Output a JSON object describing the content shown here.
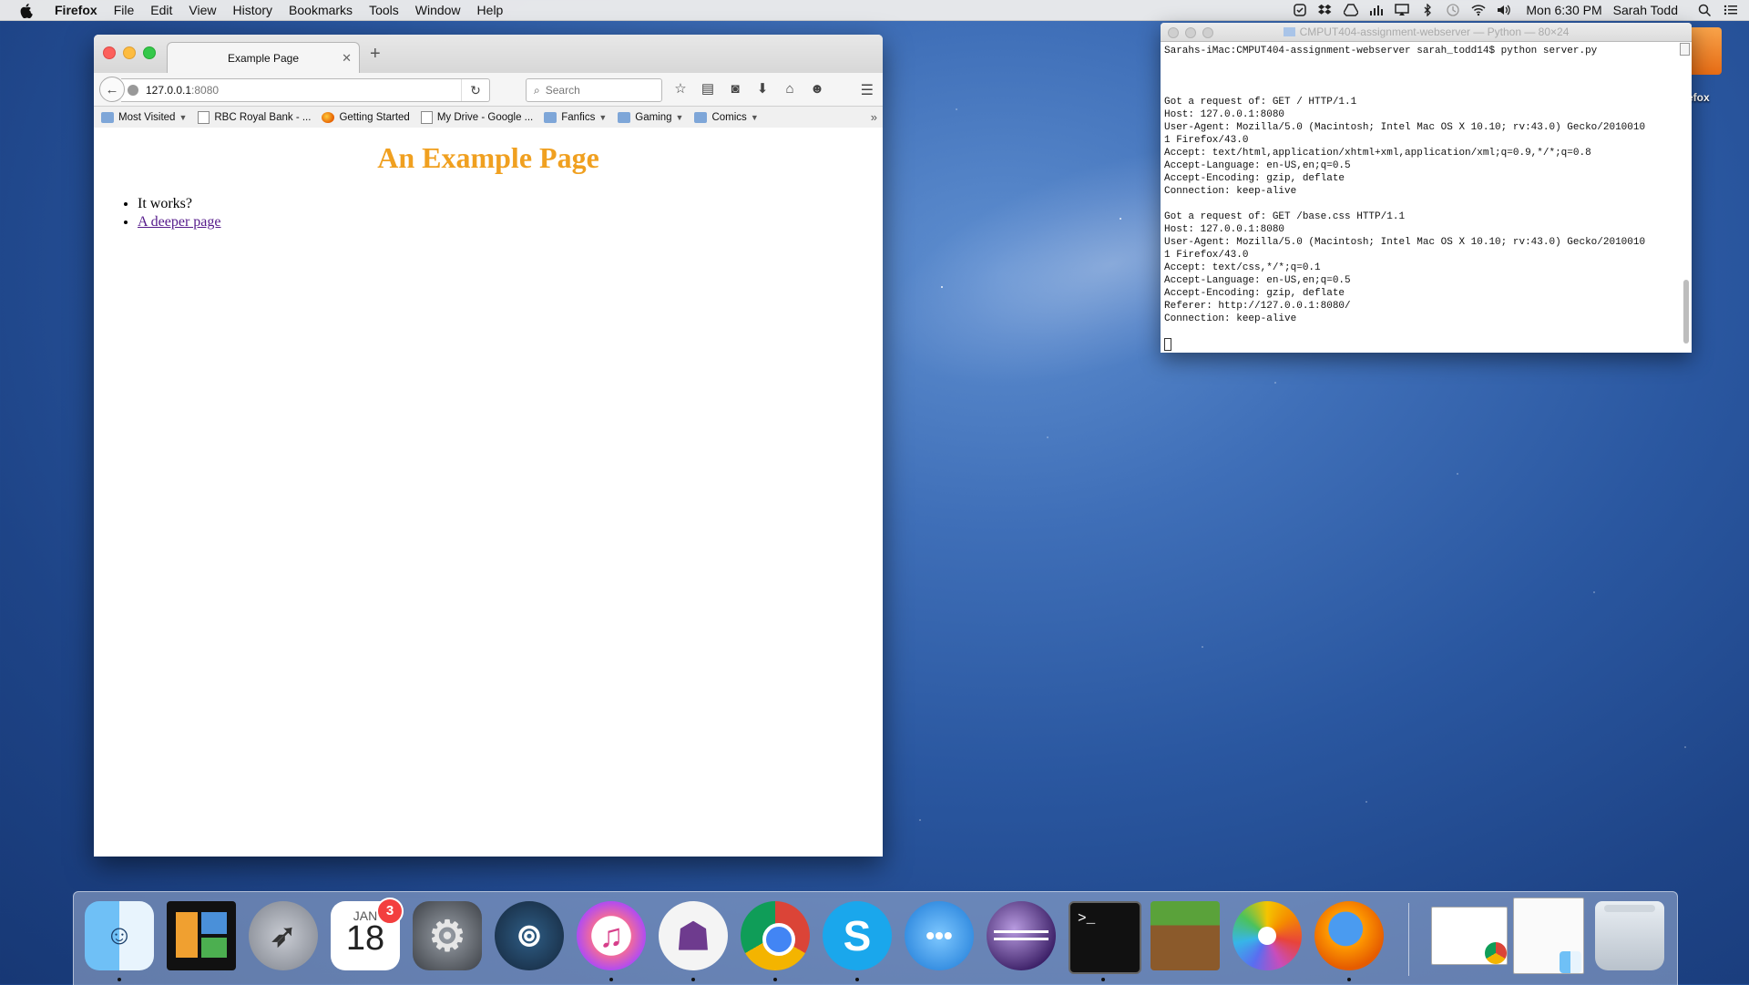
{
  "menubar": {
    "app_name": "Firefox",
    "menus": [
      "File",
      "Edit",
      "View",
      "History",
      "Bookmarks",
      "Tools",
      "Window",
      "Help"
    ],
    "clock": "Mon 6:30 PM",
    "user": "Sarah Todd"
  },
  "firefox": {
    "tab_title": "Example Page",
    "url_host": "127.0.0.1",
    "url_port": ":8080",
    "search_placeholder": "Search",
    "bookmarks": [
      {
        "label": "Most Visited",
        "icon": "folder-icon",
        "has_caret": true
      },
      {
        "label": "RBC Royal Bank - ...",
        "icon": "page-icon",
        "has_caret": false
      },
      {
        "label": "Getting Started",
        "icon": "firefox-icon",
        "has_caret": false
      },
      {
        "label": "My Drive - Google ...",
        "icon": "page-icon",
        "has_caret": false
      },
      {
        "label": "Fanfics",
        "icon": "folder-icon",
        "has_caret": true
      },
      {
        "label": "Gaming",
        "icon": "folder-icon",
        "has_caret": true
      },
      {
        "label": "Comics",
        "icon": "folder-icon",
        "has_caret": true
      }
    ],
    "page": {
      "heading": "An Example Page",
      "items": [
        "It works?"
      ],
      "link_text": "A deeper page",
      "heading_color": "#f0a020"
    }
  },
  "terminal": {
    "title": "CMPUT404-assignment-webserver — Python — 80×24",
    "lines": [
      "Sarahs-iMac:CMPUT404-assignment-webserver sarah_todd14$ python server.py",
      "",
      "",
      "",
      "Got a request of: GET / HTTP/1.1",
      "Host: 127.0.0.1:8080",
      "User-Agent: Mozilla/5.0 (Macintosh; Intel Mac OS X 10.10; rv:43.0) Gecko/2010010",
      "1 Firefox/43.0",
      "Accept: text/html,application/xhtml+xml,application/xml;q=0.9,*/*;q=0.8",
      "Accept-Language: en-US,en;q=0.5",
      "Accept-Encoding: gzip, deflate",
      "Connection: keep-alive",
      "",
      "Got a request of: GET /base.css HTTP/1.1",
      "Host: 127.0.0.1:8080",
      "User-Agent: Mozilla/5.0 (Macintosh; Intel Mac OS X 10.10; rv:43.0) Gecko/2010010",
      "1 Firefox/43.0",
      "Accept: text/css,*/*;q=0.1",
      "Accept-Language: en-US,en;q=0.5",
      "Accept-Encoding: gzip, deflate",
      "Referer: http://127.0.0.1:8080/",
      "Connection: keep-alive",
      ""
    ]
  },
  "desktop": {
    "icon_label": "efox"
  },
  "dock": {
    "calendar_month": "JAN",
    "calendar_day": "18",
    "calendar_badge": "3",
    "apps": [
      "finder-icon",
      "tiles-app-icon",
      "launchpad-icon",
      "calendar-icon",
      "system-preferences-icon",
      "steam-icon",
      "itunes-icon",
      "github-icon",
      "chrome-icon",
      "skype-icon",
      "messages-icon",
      "eclipse-icon",
      "terminal-icon",
      "minecraft-icon",
      "photos-icon",
      "firefox-icon",
      "chrome-minimized-window-icon",
      "finder-minimized-window-icon",
      "trash-icon"
    ]
  }
}
